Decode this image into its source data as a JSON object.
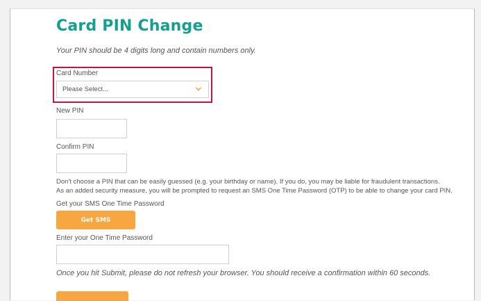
{
  "form": {
    "title": "Card PIN Change",
    "intro": "Your PIN should be 4 digits long and contain numbers only.",
    "card_number": {
      "label": "Card Number",
      "value": "Please Select..."
    },
    "new_pin": {
      "label": "New PIN"
    },
    "confirm_pin": {
      "label": "Confirm PIN"
    },
    "warning_1": "Don't choose a PIN that can be easily guessed (e.g. your birthday or name). If you do, you may be liable for fraudulent transactions.",
    "warning_2": "As an added security measure, you will be prompted to request an SMS One Time Password (OTP) to be able to change your card PIN.",
    "sms": {
      "label": "Get your SMS One Time Password",
      "button": "Get SMS"
    },
    "otp": {
      "label": "Enter your One Time Password"
    },
    "submit_note": "Once you hit Submit, please do not refresh your browser. You should receive a confirmation within 60 seconds."
  },
  "colors": {
    "title": "#14a08e",
    "accent": "#f7a640",
    "highlight": "#c0163e",
    "text": "#555555"
  },
  "icons": {
    "select_chevron": "chevron-down-icon"
  }
}
